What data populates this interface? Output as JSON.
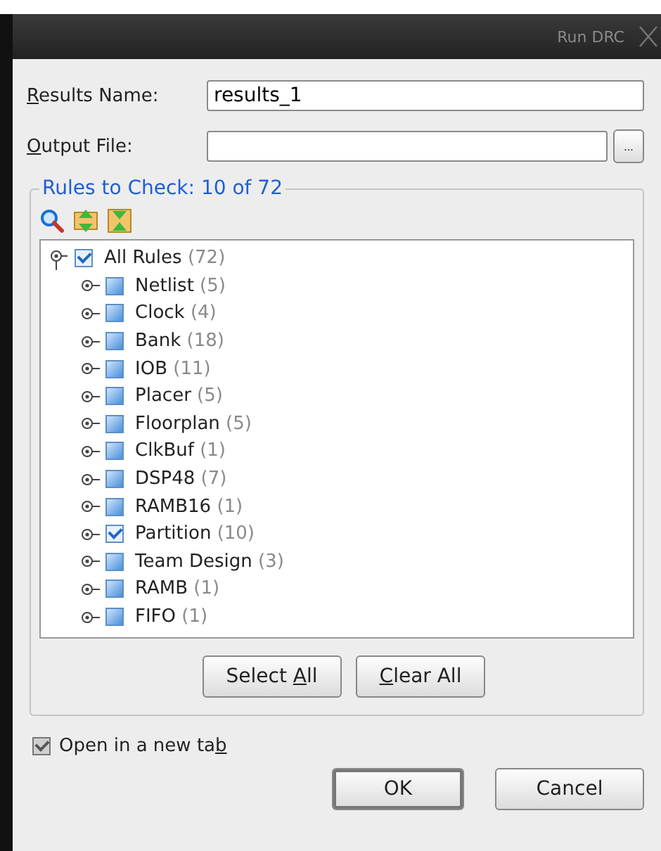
{
  "window": {
    "title": "Run DRC"
  },
  "results_name": {
    "label": {
      "key": "R",
      "post": "esults Name:"
    },
    "value": "results_1"
  },
  "output_file": {
    "label": {
      "key": "O",
      "post": "utput File:"
    },
    "browse": "..."
  },
  "rules_group": {
    "title": "Rules to Check: 10 of 72",
    "tree": [
      {
        "name": "All Rules",
        "count": "(72)",
        "checked": true,
        "expanded": true,
        "children": [
          {
            "name": "Netlist",
            "count": "(5)",
            "checked": false,
            "expanded": false
          },
          {
            "name": "Clock",
            "count": "(4)",
            "checked": false,
            "expanded": false
          },
          {
            "name": "Bank",
            "count": "(18)",
            "checked": false,
            "expanded": false
          },
          {
            "name": "IOB",
            "count": "(11)",
            "checked": false,
            "expanded": false
          },
          {
            "name": "Placer",
            "count": "(5)",
            "checked": false,
            "expanded": false
          },
          {
            "name": "Floorplan",
            "count": "(5)",
            "checked": false,
            "expanded": false
          },
          {
            "name": "ClkBuf",
            "count": "(1)",
            "checked": false,
            "expanded": false
          },
          {
            "name": "DSP48",
            "count": "(7)",
            "checked": false,
            "expanded": false
          },
          {
            "name": "RAMB16",
            "count": "(1)",
            "checked": false,
            "expanded": false
          },
          {
            "name": "Partition",
            "count": "(10)",
            "checked": true,
            "expanded": false
          },
          {
            "name": "Team Design",
            "count": "(3)",
            "checked": false,
            "expanded": false
          },
          {
            "name": "RAMB",
            "count": "(1)",
            "checked": false,
            "expanded": false
          },
          {
            "name": "FIFO",
            "count": "(1)",
            "checked": false,
            "expanded": false
          }
        ]
      }
    ],
    "buttons": [
      {
        "pre": "Select ",
        "key": "A",
        "post": "ll"
      },
      {
        "key": "C",
        "post": "lear All"
      }
    ]
  },
  "open_new_tab": {
    "label": {
      "pre": "Open in a new ta",
      "key": "b"
    },
    "checked": true
  },
  "dialog_buttons": [
    {
      "label": "OK",
      "default": true
    },
    {
      "label": "Cancel",
      "default": false
    }
  ]
}
